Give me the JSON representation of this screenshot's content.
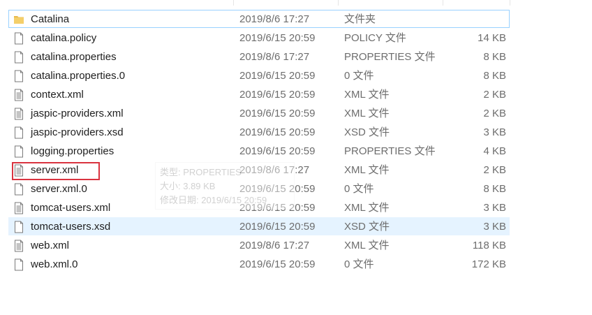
{
  "files": [
    {
      "name": "Catalina",
      "date": "2019/8/6 17:27",
      "type": "文件夹",
      "size": "",
      "icon": "folder-icon"
    },
    {
      "name": "catalina.policy",
      "date": "2019/6/15 20:59",
      "type": "POLICY 文件",
      "size": "14 KB",
      "icon": "file-icon"
    },
    {
      "name": "catalina.properties",
      "date": "2019/8/6 17:27",
      "type": "PROPERTIES 文件",
      "size": "8 KB",
      "icon": "file-icon"
    },
    {
      "name": "catalina.properties.0",
      "date": "2019/6/15 20:59",
      "type": "0 文件",
      "size": "8 KB",
      "icon": "file-icon"
    },
    {
      "name": "context.xml",
      "date": "2019/6/15 20:59",
      "type": "XML 文件",
      "size": "2 KB",
      "icon": "text-file-icon"
    },
    {
      "name": "jaspic-providers.xml",
      "date": "2019/6/15 20:59",
      "type": "XML 文件",
      "size": "2 KB",
      "icon": "text-file-icon"
    },
    {
      "name": "jaspic-providers.xsd",
      "date": "2019/6/15 20:59",
      "type": "XSD 文件",
      "size": "3 KB",
      "icon": "file-icon"
    },
    {
      "name": "logging.properties",
      "date": "2019/6/15 20:59",
      "type": "PROPERTIES 文件",
      "size": "4 KB",
      "icon": "file-icon"
    },
    {
      "name": "server.xml",
      "date": "2019/8/6 17:27",
      "type": "XML 文件",
      "size": "2 KB",
      "icon": "text-file-icon"
    },
    {
      "name": "server.xml.0",
      "date": "2019/6/15 20:59",
      "type": "0 文件",
      "size": "8 KB",
      "icon": "file-icon"
    },
    {
      "name": "tomcat-users.xml",
      "date": "2019/6/15 20:59",
      "type": "XML 文件",
      "size": "3 KB",
      "icon": "text-file-icon"
    },
    {
      "name": "tomcat-users.xsd",
      "date": "2019/6/15 20:59",
      "type": "XSD 文件",
      "size": "3 KB",
      "icon": "file-icon"
    },
    {
      "name": "web.xml",
      "date": "2019/8/6 17:27",
      "type": "XML 文件",
      "size": "118 KB",
      "icon": "text-file-icon"
    },
    {
      "name": "web.xml.0",
      "date": "2019/6/15 20:59",
      "type": "0 文件",
      "size": "172 KB",
      "icon": "file-icon"
    }
  ],
  "tooltip": {
    "line1": "类型: PROPERTIES",
    "line2": "大小: 3.89 KB",
    "line3": "修改日期: 2019/6/15 20:59"
  },
  "colors": {
    "hover_bg": "#e5f3ff",
    "focus_border": "#99d1ff",
    "highlight": "#d9333f",
    "folder": "#e8b84a"
  }
}
